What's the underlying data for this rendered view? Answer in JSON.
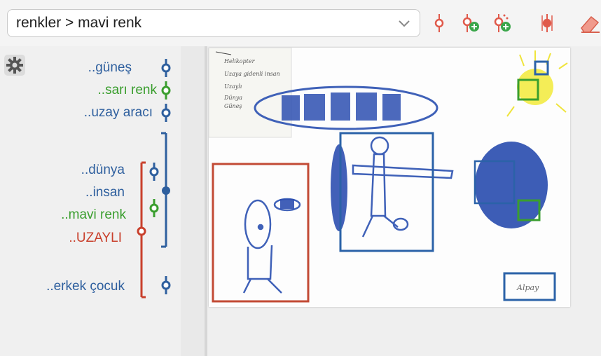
{
  "toolbar": {
    "path_value": "renkler > mavi renk",
    "icons": [
      "dropdown-chevron-icon",
      "ring-tag-icon",
      "ring-tag-add-icon",
      "ring-tag-add-multi-icon",
      "ring-tag-toggle-icon",
      "eraser-icon"
    ]
  },
  "sidebar": {
    "items": [
      {
        "label": "..güneş",
        "color": "#2e5f9e"
      },
      {
        "label": "..sarı renk",
        "color": "#3a9e2e"
      },
      {
        "label": "..uzay aracı",
        "color": "#2e5f9e"
      },
      {
        "label": "..dünya",
        "color": "#2e5f9e"
      },
      {
        "label": "..insan",
        "color": "#2e5f9e"
      },
      {
        "label": "..mavi renk",
        "color": "#3a9e2e"
      },
      {
        "label": "..UZAYLI",
        "color": "#c9402c"
      },
      {
        "label": "..erkek çocuk",
        "color": "#2e5f9e"
      }
    ]
  },
  "drawing": {
    "note_lines": [
      "Helikopter",
      "Uzaya gidenli insan",
      "Uzaylı",
      "Dünya",
      "Güneş"
    ],
    "signature": "Alpay"
  },
  "colors": {
    "blue": "#2e5f9e",
    "green": "#3a9e2e",
    "red": "#c9402c",
    "yellow": "#f2e830"
  }
}
